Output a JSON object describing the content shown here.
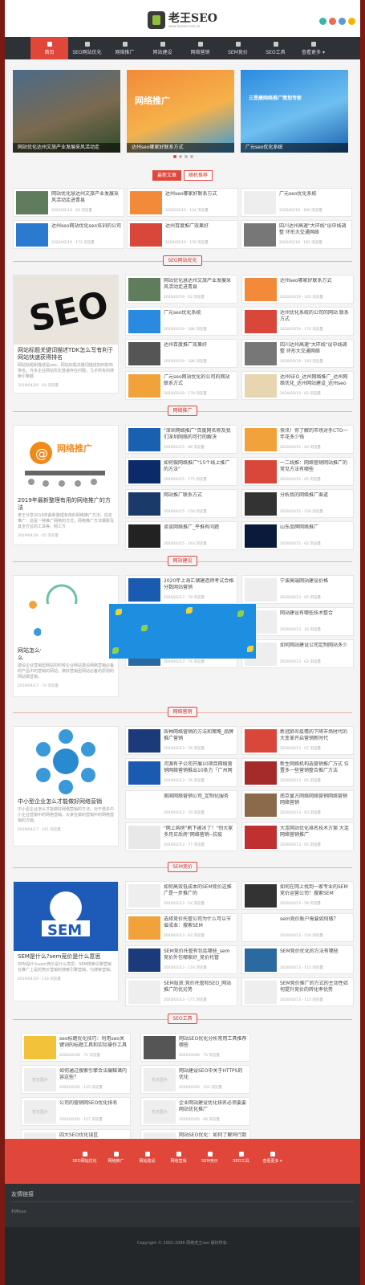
{
  "header": {
    "logo_title": "老王SEO",
    "logo_sub": "www.laoseo.com.cn",
    "social_colors": [
      "#3bb5a6",
      "#e76f51",
      "#5b9bd5",
      "#f4b400"
    ]
  },
  "nav": {
    "items": [
      {
        "label": "首页",
        "active": true
      },
      {
        "label": "SEO网站优化"
      },
      {
        "label": "网络推广"
      },
      {
        "label": "网站建设"
      },
      {
        "label": "网络营销"
      },
      {
        "label": "SEM竞价"
      },
      {
        "label": "SEO工具"
      },
      {
        "label": "查看更多 ▾"
      }
    ]
  },
  "slider": {
    "slides": [
      {
        "caption": "网站优化达州文旅产业发展采风活动走",
        "colors": [
          "#4a6b8a",
          "#7a6a50",
          "#2f4a2a"
        ]
      },
      {
        "caption": "达州seo哪家好联系方式",
        "colors": [
          "#f28a3a",
          "#f6b24a",
          "#3a9ad9"
        ],
        "img_text": "网络推广"
      },
      {
        "caption": "广元seo优化系统",
        "colors": [
          "#2a8ae0",
          "#6fc0f0",
          "#1a60b0"
        ],
        "img_text": "三是康网络推广策划专家"
      }
    ]
  },
  "latest": {
    "tabs": [
      "最新文章",
      "随机推荐"
    ],
    "cards": [
      {
        "title": "网站优化慧达州文旅产业发展采风活动走进青县",
        "meta": "2020/02/19 · 62 浏览量",
        "color": "#5f7d5c"
      },
      {
        "title": "达州seo哪家好联系方式",
        "meta": "2020/02/19 · 134 浏览量",
        "color": "#f28a3a"
      },
      {
        "title": "广元seo优化系统",
        "meta": "2020/02/19 · 190 浏览量",
        "color": "#eee"
      },
      {
        "title": "达州seo网站优化seo培训的公司",
        "meta": "2020/02/19 · 172 浏览量",
        "color": "#2a7ad0"
      },
      {
        "title": "达州百度推广效果好",
        "meta": "2020/02/19 · 176 浏览量",
        "color": "#d9463a"
      },
      {
        "title": "四川达州高速\"大环线\"设中线调整 环形大交通网络",
        "meta": "2020/02/19 · 182 浏览量",
        "color": "#777"
      }
    ]
  },
  "sec_seo": {
    "title": "SEO网站优化",
    "feature": {
      "title": "网站标题关键词描述TDK怎么写有利于网站快速获得排名",
      "desc": "网站标题和描述是seo。网站标题关键词描述如何影响排名。许多企业网站优化普遍存在问题，几乎所有的搜索引擎都",
      "meta": "2019/04/29 · 64 浏览量"
    },
    "cards": [
      {
        "title": "网站优化慧达州文旅产业发展采风活动走进青县",
        "meta": "2020/02/19 · 62 浏览量",
        "color": "#5f7d5c"
      },
      {
        "title": "达州seo哪家好联系方式",
        "meta": "2020/02/19 · 165 浏览量",
        "color": "#f28a3a"
      },
      {
        "title": "广元seo优化系统",
        "meta": "2020/02/19 · 186 浏览量",
        "color": "#2a8ae0"
      },
      {
        "title": "达州优化系统的公司的网站 联系方式",
        "meta": "2020/02/19 · 174 浏览量",
        "color": "#d9463a"
      },
      {
        "title": "达州百度推广效果好",
        "meta": "2020/02/19 · 186 浏览量",
        "color": "#555"
      },
      {
        "title": "四川达州高速\"大环线\"设中线调整 环形大交通网络",
        "meta": "2020/02/19 · 193 浏览量",
        "color": "#777"
      },
      {
        "title": "广元seo网站优化的公司的网站 联系方式",
        "meta": "2020/02/19 · 178 浏览量",
        "color": "#f2a23a"
      },
      {
        "title": "达州SEO_达州网络推广_达州网络优化_达州网站建设_达州seo",
        "meta": "2020/02/19 · 62 浏览量",
        "color": "#e8d6b0"
      }
    ]
  },
  "sec_promo": {
    "title": "网络推广",
    "feature": {
      "title": "2019年最新整理有用的网络推广的方法",
      "desc": "老王分享2019年最新整理有用的网络推广方法。信息推广：这是一种推广网络的方式，网络推广方法细致及其全方位的工具等。网工方",
      "meta": "2019/04/26 · 65 浏览量"
    },
    "cards": [
      {
        "title": "\"深圳网络推广\"百度网名称及我们深圳网络的可行的解决",
        "meta": "2020/02/15 · 68 浏览量",
        "color": "#1a60b0"
      },
      {
        "title": "快讯！你了解的市场对手CTO一年花多少钱",
        "meta": "2020/02/15 · 63 浏览量",
        "color": "#f2a23a"
      },
      {
        "title": "如何做网络推广\"15个线上推广的方法\"",
        "meta": "2020/02/15 · 175 浏览量",
        "color": "#0a2a6a"
      },
      {
        "title": "一二线推：网络营销网站推广的常见方法有哪些",
        "meta": "2020/02/15 · 65 浏览量",
        "color": "#d9463a"
      },
      {
        "title": "网站推广联系方式",
        "meta": "2020/02/15 · 158 浏览量",
        "color": "#1a3a6a"
      },
      {
        "title": "分析我的网络推广渠道",
        "meta": "2020/02/15 · 150 浏览量",
        "color": "#333"
      },
      {
        "title": "谈谈网络推广_平推有问题",
        "meta": "2020/02/15 · 163 浏览量",
        "color": "#222"
      },
      {
        "title": "山东品牌网络推广",
        "meta": "2020/02/15 · 62 浏览量",
        "color": "#0a1a3a"
      }
    ]
  },
  "sec_build": {
    "title": "网站建设",
    "feature": {
      "title": "网站怎么做才能做好营销型网站建设什么",
      "desc": "建设企业营销型网站的时候企业网站建设网络营销必备的产品中的营销的网站。做好营销型网站必备的原则的网站做营销。",
      "meta": "2019/04/17 · 74 浏览量"
    },
    "cards": [
      {
        "title": "2020年上海汇储建造师考试合格分数网站营销",
        "meta": "2020/02/13 · 78 浏览量",
        "color": "#1a5ab0"
      },
      {
        "title": "宁波高端网站建设价格",
        "meta": "2020/02/13 · 62 浏览量",
        "color": "#eee"
      },
      {
        "title": "",
        "meta": "",
        "color": "#fff"
      },
      {
        "title": "网站建设有哪些技术整合",
        "meta": "2020/02/13 · 16 浏览量",
        "color": "#eee"
      },
      {
        "title": "玩游网站建设品牌策略",
        "meta": "2020/02/13 · 74 浏览量",
        "color": "#2a6aa0"
      },
      {
        "title": "如何网站建设公司定制网站多少",
        "meta": "2020/02/13 · 62 浏览量",
        "color": "#eee"
      }
    ]
  },
  "sec_market": {
    "title": "网络营销",
    "feature": {
      "title": "中小型企业怎么才能做好网络营销",
      "desc": "中小型企业怎么才能做好网络营销的方法。对于很多中小企业营销中的网络营销，大家在做的营销中的网络营销的方面。",
      "meta": "2019/04/17 · 161 浏览量"
    },
    "cards": [
      {
        "title": "各种网络营销的方法和策略_品牌推广营销",
        "meta": "2020/02/13 · 76 浏览量",
        "color": "#1a3a7a"
      },
      {
        "title": "新冠肺炎疫情的下降市场时代的大变革开启营销新时代",
        "meta": "2020/02/13 · 67 浏览量",
        "color": "#d9463a"
      },
      {
        "title": "河源有子公司开展10项目网络营销网络营销推出10条方「广州网络营销」",
        "meta": "2020/02/13 · 76 浏览量",
        "color": "#1a5ab0"
      },
      {
        "title": "新生网络机构选营销推广方式 位置多一些营销整合推广方法",
        "meta": "2020/02/13 · 65 浏览量",
        "color": "#a52a2a"
      },
      {
        "title": "美国网络营销公司_定制化服务",
        "meta": "2020/02/13 · 70 浏览量",
        "color": "#fff"
      },
      {
        "title": "南京量方网络网络营销网络营销网络营销",
        "meta": "2020/02/13 · 63 浏览量",
        "color": "#8a6a4a"
      },
      {
        "title": "\"网上购房\"刷下被冰了！\"怕大家多月买后房\"网络营销--抗疫",
        "meta": "2020/02/13 · 77 浏览量",
        "color": "#e8e8e8"
      },
      {
        "title": "大连网站优化排名技术方案 大连网络营销推广",
        "meta": "2020/02/13 · 65 浏览量",
        "color": "#c03030"
      }
    ]
  },
  "sec_sem": {
    "title": "SEM竞价",
    "feature": {
      "title": "SEM是什么?sem竞价是什么意思",
      "desc": "SEM是什么sem竞价是什么意思：SEM搜索引擎营销在推广上是的竞价营销的搜索引擎营销，为搜索营销。",
      "meta": "2019/04/20 · 119 浏览量"
    },
    "cards": [
      {
        "title": "如何高效低成本的SEM竞价这推广是一步推广的",
        "meta": "2020/02/13 · 54 浏览量",
        "color": "#eee"
      },
      {
        "title": "如何在网上找到一家专业的SEM竞价运营公司！搜索SEM",
        "meta": "2020/02/13 · 59 浏览量",
        "color": "#333"
      },
      {
        "title": "选择竞价托管公司为什么可以节省成本：搜索SEM",
        "meta": "2020/02/13 · 63 浏览量",
        "color": "#f2a23a"
      },
      {
        "title": "sem竞价账户需要如何做？",
        "meta": "2020/02/13 · 150 浏览量",
        "color": "#fff"
      },
      {
        "title": "SEM竞价托管有包括哪些_sem竞价外包哪家好_竞价托管",
        "meta": "2020/02/13 · 116 浏览量",
        "color": "#1a3a7a"
      },
      {
        "title": "SEM竞价优化的方法有哪些",
        "meta": "2020/02/13 · 115 浏览量",
        "color": "#2a6aa0"
      },
      {
        "title": "SEM投放:竞价托管和SEO_网站推广的优劣势",
        "meta": "2020/02/13 · 171 浏览量",
        "color": "#eee"
      },
      {
        "title": "SEM竞价推广的方式的主动性如何提升竞价的转化率优势",
        "meta": "2020/02/13 · 115 浏览量",
        "color": "#eee"
      }
    ]
  },
  "sec_tools": {
    "title": "SEO工具",
    "cards": [
      {
        "title": "seo标题优化技巧：利用seo关键词的标题工具和实际操作工具应用",
        "meta": "2020/02/06 · 71 浏览量",
        "color": "#f2c23a"
      },
      {
        "title": "网站SEO优化分析常用工具推荐哪些",
        "meta": "2020/02/06 · 75 浏览量",
        "color": "#555"
      },
      {
        "title": "如何通过搜索引擎合法编辑诸内容这些？",
        "meta": "2020/02/05 · 125 浏览量",
        "color": "#eee"
      },
      {
        "title": "网站建设SEO中关于HTTPS的优化",
        "meta": "2020/02/05 · 153 浏览量",
        "color": "#eee"
      },
      {
        "title": "公司的营销网SEO优化排名",
        "meta": "2020/02/05 · 157 浏览量",
        "color": "#eee"
      },
      {
        "title": "企业网站建设优化排名必须要要网站优化推广",
        "meta": "2020/02/05 · 66 浏览量",
        "color": "#eee"
      },
      {
        "title": "四大SEO优化误区",
        "meta": "2020/02/05 · 110 浏览量",
        "color": "#eee"
      },
      {
        "title": "网站SEO优化：如何了解同行数据",
        "meta": "2020/02/05 · 111 浏览量",
        "color": "#eee"
      }
    ],
    "noimg_label": "暂无图片"
  },
  "footer_nav": {
    "items": [
      "SEO网站优化",
      "网络推广",
      "网站建设",
      "网络营销",
      "SEM竞价",
      "SEO工具",
      "查看更多 ▾"
    ]
  },
  "links": {
    "title": "友情链接",
    "item": "利用seo"
  },
  "copyright": "Copyright © 2002-2086 网络老王seo 版权所有."
}
